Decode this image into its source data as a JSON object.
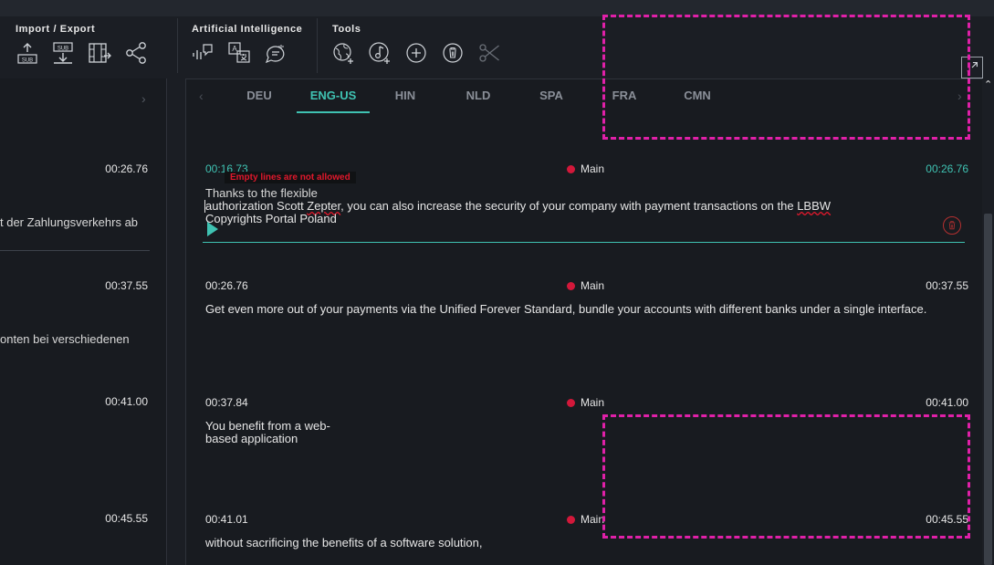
{
  "toolbar": {
    "import_export": {
      "title": "Import / Export",
      "sub_label": "SUB"
    },
    "ai": {
      "title": "Artificial Intelligence"
    },
    "tools": {
      "title": "Tools"
    }
  },
  "tabs": [
    "DEU",
    "ENG-US",
    "HIN",
    "NLD",
    "SPA",
    "FRA",
    "CMN"
  ],
  "active_tab": "ENG-US",
  "left_panel": {
    "times": [
      "00:26.76",
      "00:37.55",
      "00:41.00",
      "00:45.55"
    ],
    "texts": [
      "t der Zahlungsverkehrs ab",
      "onten bei verschiedenen"
    ]
  },
  "segments": [
    {
      "start": "00:16.73",
      "end": "00:26.76",
      "speaker": "Main",
      "error": "Empty lines are not allowed",
      "text_line1": "Thanks to the flexible",
      "text_line2a": "authorization Scott ",
      "text_line2b": "Zepter",
      "text_line2c": ", you can also increase the security of your company with payment transactions on the ",
      "text_line2d": "LBBW",
      "text_line3": "Copyrights Portal Poland"
    },
    {
      "start": "00:26.76",
      "end": "00:37.55",
      "speaker": "Main",
      "text": "Get even more out of your payments via the Unified Forever Standard, bundle your accounts with different banks under a single interface."
    },
    {
      "start": "00:37.84",
      "end": "00:41.00",
      "speaker": "Main",
      "text_line1": "You benefit from a web-",
      "text_line2": "based application"
    },
    {
      "start": "00:41.01",
      "end": "00:45.55",
      "speaker": "Main",
      "text": "without sacrificing the benefits of a software solution,"
    }
  ],
  "colors": {
    "accent": "#3fc2b2",
    "speaker_dot": "#d2183a",
    "error": "#e0182c",
    "highlight": "#e020a8"
  }
}
